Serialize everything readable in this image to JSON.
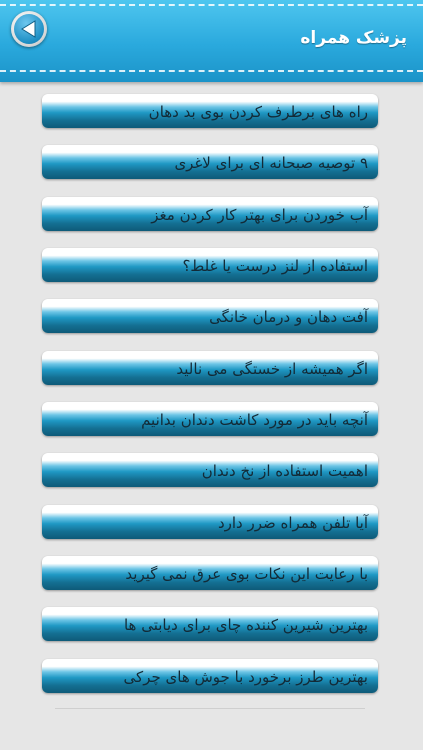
{
  "header": {
    "title": "پزشک همراه",
    "back_icon": "back-arrow-icon",
    "accent_color": "#2aa9dd"
  },
  "items": [
    {
      "label": "راه های برطرف کردن بوی بد دهان"
    },
    {
      "label": "۹ توصیه صبحانه ای برای لاغری"
    },
    {
      "label": "آب خوردن برای بهتر کار کردن مغز"
    },
    {
      "label": "استفاده از لنز درست یا غلط؟"
    },
    {
      "label": "آفت دهان و درمان خانگی"
    },
    {
      "label": "اگر همیشه از خستگی می نالید"
    },
    {
      "label": "آنچه باید در مورد کاشت دندان بدانیم"
    },
    {
      "label": "اهمیت استفاده از نخ دندان"
    },
    {
      "label": "آیا تلفن همراه ضرر دارد"
    },
    {
      "label": "با رعایت این نکات بوی عرق نمی گیرید"
    },
    {
      "label": "بهترین شیرین کننده چای برای دیابتی ها"
    },
    {
      "label": "بهترین طرز برخورد با جوش های چرکی"
    }
  ]
}
